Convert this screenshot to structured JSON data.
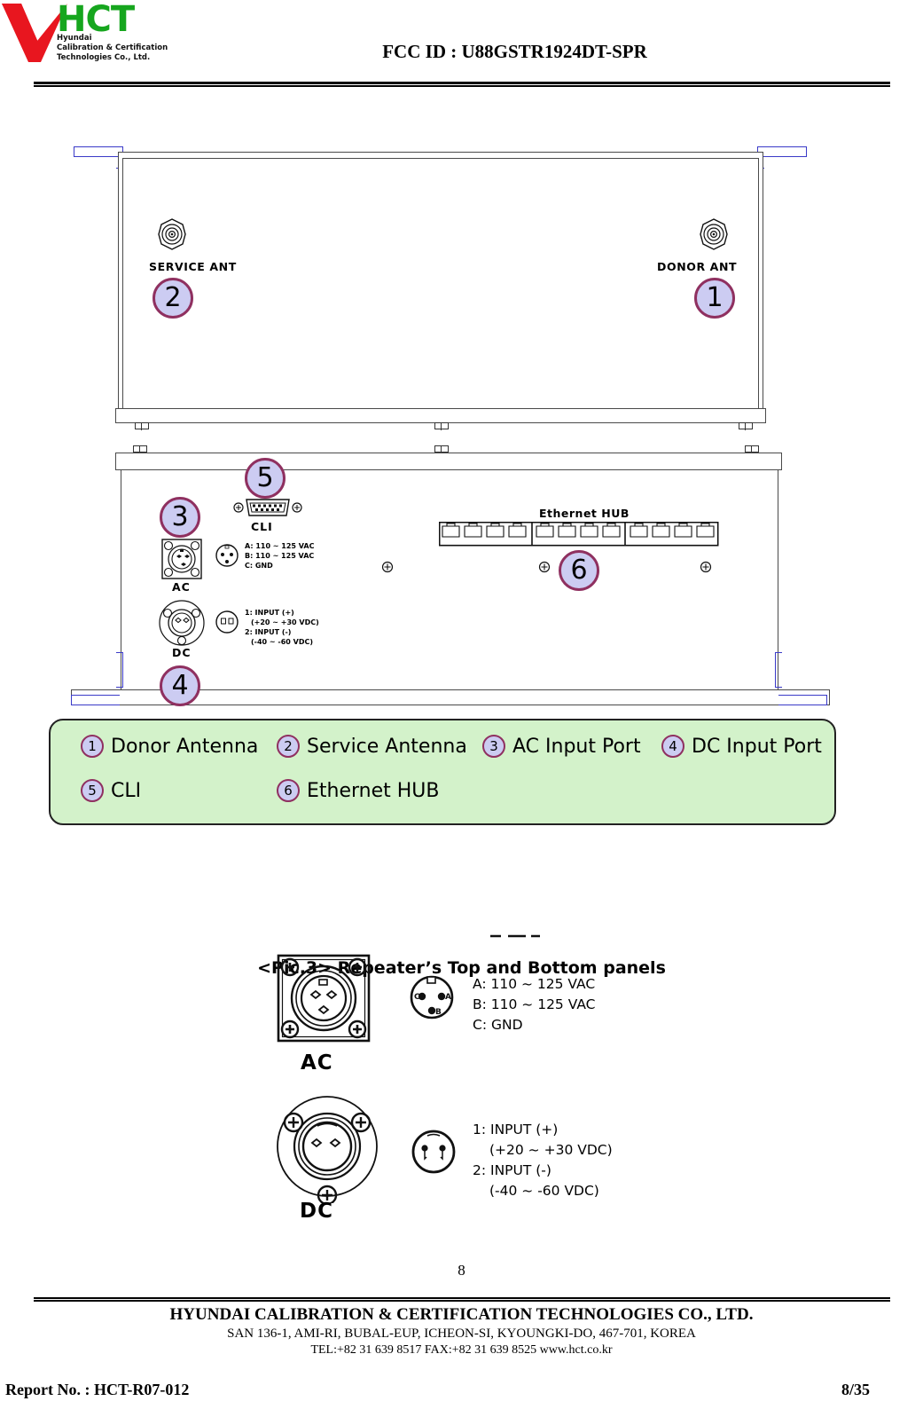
{
  "header": {
    "logo": {
      "brand": "HCT",
      "subtitle_lines": [
        "Hyundai",
        "Calibration & Certification",
        "Technologies Co., Ltd."
      ],
      "brand_color": "#16a61e",
      "check_color": "#e8161f"
    },
    "fcc_id": "FCC ID : U88GSTR1924DT-SPR"
  },
  "figure": {
    "top_panel": {
      "left_port_label": "SERVICE ANT",
      "right_port_label": "DONOR ANT",
      "callouts": [
        {
          "num": "2",
          "for": "SERVICE ANT"
        },
        {
          "num": "1",
          "for": "DONOR ANT"
        }
      ]
    },
    "bottom_panel": {
      "cli_label": "CLI",
      "ac_label": "AC",
      "dc_label": "DC",
      "ethernet_label": "Ethernet HUB",
      "ethernet_port_count": 12,
      "ac_pin_lines": [
        "A: 110 ~ 125 VAC",
        "B: 110 ~ 125 VAC",
        "C: GND"
      ],
      "dc_pin_lines": [
        "1: INPUT (+)",
        "(+20 ~ +30 VDC)",
        "2: INPUT (-)",
        "(-40 ~ -60 VDC)"
      ],
      "callouts": [
        {
          "num": "5",
          "for": "CLI"
        },
        {
          "num": "3",
          "for": "AC"
        },
        {
          "num": "4",
          "for": "DC"
        },
        {
          "num": "6",
          "for": "Ethernet HUB"
        }
      ]
    },
    "legend": {
      "bg_color": "#d3f2ca",
      "bubble_fill": "#ccccf2",
      "bubble_border": "#8f3060",
      "row1": [
        {
          "num": "1",
          "label": "Donor Antenna"
        },
        {
          "num": "2",
          "label": "Service Antenna"
        },
        {
          "num": "3",
          "label": "AC Input Port"
        },
        {
          "num": "4",
          "label": "DC Input Port"
        }
      ],
      "row2": [
        {
          "num": "5",
          "label": "CLI"
        },
        {
          "num": "6",
          "label": "Ethernet HUB"
        }
      ]
    },
    "caption": "<Pic.3> Repeater’s Top and Bottom panels"
  },
  "detail": {
    "ac": {
      "caption": "AC",
      "pin_a": "A: 110 ~ 125 VAC",
      "pin_b": "B: 110 ~ 125 VAC",
      "pin_c": "C: GND",
      "pin_marks": [
        "A",
        "B",
        "C"
      ]
    },
    "dc": {
      "caption": "DC",
      "line1": "1: INPUT (+)",
      "line2": "(+20 ~ +30 VDC)",
      "line3": "2: INPUT (-)",
      "line4": "(-40 ~ -60 VDC)"
    }
  },
  "page_number": "8",
  "footer": {
    "company": "HYUNDAI CALIBRATION & CERTIFICATION TECHNOLOGIES CO., LTD.",
    "address": "SAN 136-1, AMI-RI, BUBAL-EUP, ICHEON-SI, KYOUNGKI-DO, 467-701, KOREA",
    "contact": "TEL:+82 31 639 8517    FAX:+82 31 639 8525    www.hct.co.kr",
    "report_no": "Report No. :  HCT-R07-012",
    "page_of": "8/35"
  }
}
